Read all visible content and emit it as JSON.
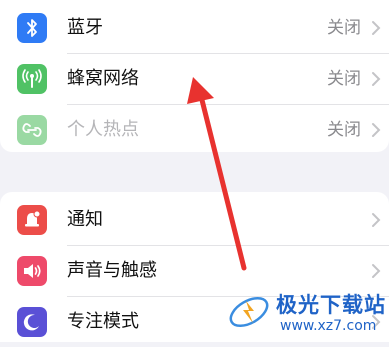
{
  "settings": {
    "connectivity": [
      {
        "label": "蓝牙",
        "value": "关闭",
        "icon": "bluetooth-icon",
        "color": "#2f7bf5"
      },
      {
        "label": "蜂窝网络",
        "value": "关闭",
        "icon": "cellular-icon",
        "color": "#50c265"
      },
      {
        "label": "个人热点",
        "value": "关闭",
        "icon": "hotspot-icon",
        "color": "#9ad9a3",
        "disabled": true
      }
    ],
    "general": [
      {
        "label": "通知",
        "icon": "notifications-icon",
        "color": "#ec4d49"
      },
      {
        "label": "声音与触感",
        "icon": "sound-icon",
        "color": "#ee4a6a"
      },
      {
        "label": "专注模式",
        "icon": "focus-moon-icon",
        "color": "#5a50d6"
      }
    ]
  },
  "watermark": {
    "title": "极光下载站",
    "url": "www.xz7.com"
  },
  "colors": {
    "annotation_arrow": "#e8322f"
  }
}
